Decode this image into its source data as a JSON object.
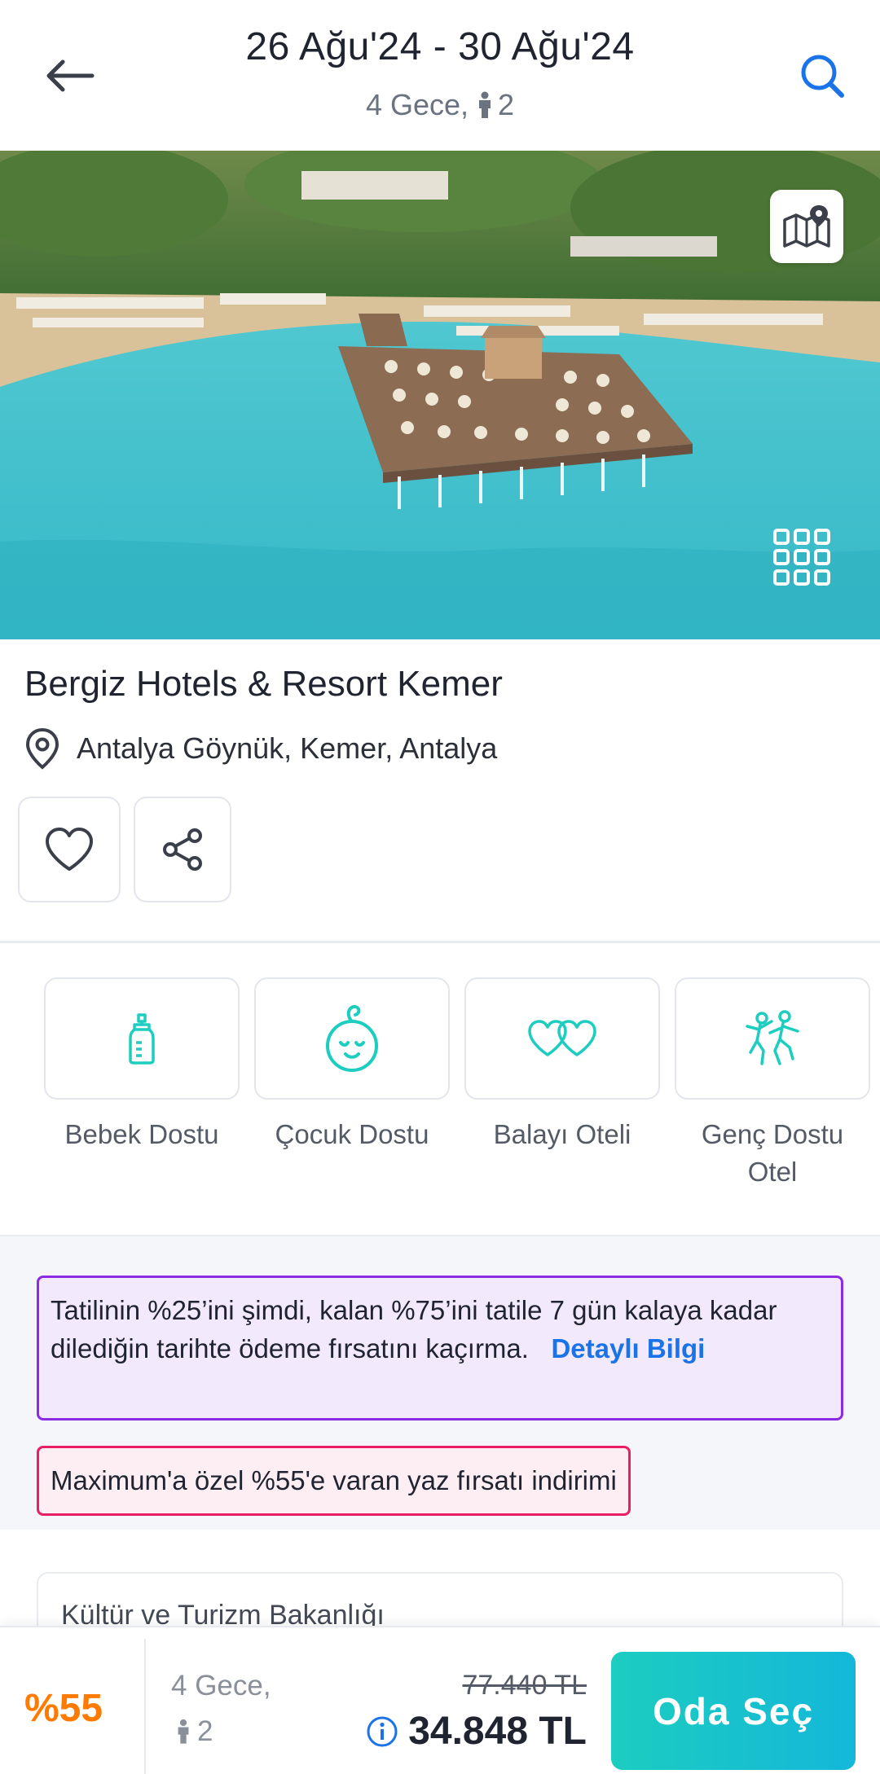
{
  "header": {
    "dates": "26 Ağu'24 - 30 Ağu'24",
    "nights": "4 Gece,",
    "guests": "2"
  },
  "hotel": {
    "name": "Bergiz Hotels & Resort Kemer",
    "location": "Antalya Göynük, Kemer, Antalya"
  },
  "features": [
    {
      "label": "Bebek Dostu",
      "icon": "baby-bottle-icon"
    },
    {
      "label": "Çocuk Dostu",
      "icon": "child-face-icon"
    },
    {
      "label": "Balayı Oteli",
      "icon": "hearts-icon"
    },
    {
      "label": "Genç Dostu Otel",
      "icon": "dancing-people-icon"
    }
  ],
  "promos": {
    "installment_text": "Tatilinin %25’ini şimdi, kalan %75’ini tatile 7 gün kalaya kadar dilediğin tarihte ödeme fırsatını kaçırma.",
    "installment_link": "Detaylı Bilgi",
    "discount_text": "Maximum'a özel %55'e varan yaz fırsatı indirimi"
  },
  "info_card": {
    "title": "Kültür ve Turizm Bakanlığı"
  },
  "bottom_bar": {
    "discount": "%55",
    "nights": "4 Gece,",
    "guests": "2",
    "old_price": "77.440 TL",
    "new_price": "34.848 TL",
    "cta": "Oda Seç"
  },
  "colors": {
    "accent_teal": "#1ccdc0",
    "discount_orange": "#ff7a00",
    "link_blue": "#1a73e8",
    "promo_purple": "#8b2be2",
    "promo_pink": "#e91e63"
  }
}
